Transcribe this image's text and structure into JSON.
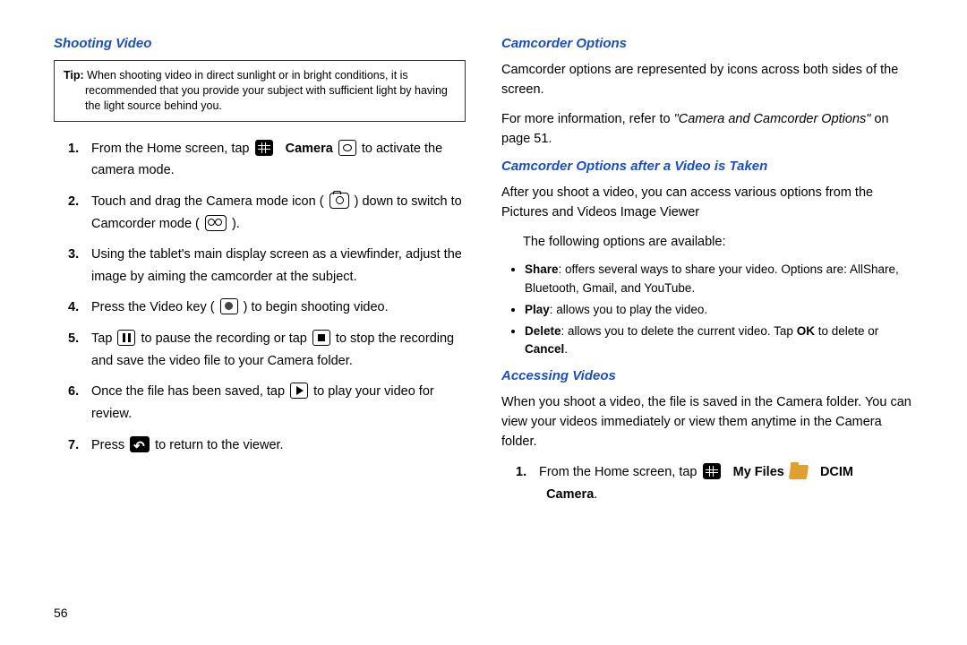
{
  "page_number": "56",
  "left": {
    "heading": "Shooting Video",
    "tip_label": "Tip: ",
    "tip_text": "When shooting video in direct sunlight or in bright conditions, it is recommended that you provide your subject with sufficient light by having the light source behind you.",
    "steps": [
      {
        "n": "1.",
        "a": "From the Home screen, tap ",
        "bold1": "Camera",
        "b": " to activate the camera mode."
      },
      {
        "n": "2.",
        "a": "Touch and drag the Camera mode icon (",
        "b": ") down to switch to Camcorder mode (",
        "c": ")."
      },
      {
        "n": "3.",
        "a": "Using the tablet's main display screen as a viewfinder, adjust the image by aiming the camcorder at the subject."
      },
      {
        "n": "4.",
        "a": "Press the Video key (",
        "b": ") to begin shooting video."
      },
      {
        "n": "5.",
        "a": "Tap ",
        "b": " to pause the recording or tap ",
        "c": " to stop the recording and save the video file to your Camera folder."
      },
      {
        "n": "6.",
        "a": "Once the file has been saved, tap ",
        "b": " to play your video for review."
      },
      {
        "n": "7.",
        "a": "Press ",
        "b": " to return to the viewer."
      }
    ]
  },
  "right": {
    "h1": "Camcorder Options",
    "p1": "Camcorder options are represented by icons across both sides of the screen.",
    "p2a": "For more information, refer to ",
    "p2_ref": "\"Camera and Camcorder Options\"",
    "p2b": " on page 51.",
    "h2": "Camcorder Options after a Video is Taken",
    "p3": "After you shoot a video, you can access various options from the Pictures and Videos Image Viewer",
    "p4": "The following options are available:",
    "bullets": [
      {
        "b": "Share",
        "t": ": offers several ways to share your video. Options are: AllShare, Bluetooth, Gmail, and YouTube."
      },
      {
        "b": "Play",
        "t": ": allows you to play the video."
      },
      {
        "b": "Delete",
        "t1": ": allows you to delete the current video. Tap ",
        "b2": "OK",
        "t2": " to delete or ",
        "b3": "Cancel",
        "t3": "."
      }
    ],
    "h3": "Accessing Videos",
    "p5": "When you shoot a video, the file is saved in the Camera folder. You can view your videos immediately or view them anytime in the Camera folder.",
    "step1_n": "1.",
    "step1_a": "From the Home screen, tap ",
    "step1_b1": "My Files",
    "step1_b2": "DCIM",
    "step1_b3": "Camera",
    "step1_end": "."
  }
}
